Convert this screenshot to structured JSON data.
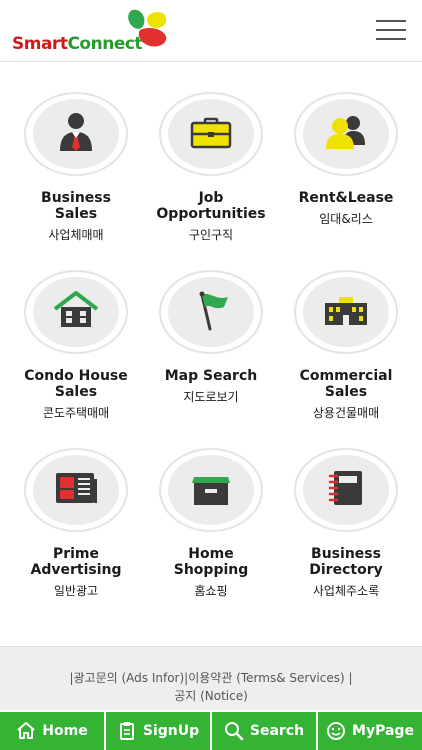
{
  "app": {
    "logo_part1": "Smart",
    "logo_part2": "Connect"
  },
  "colors": {
    "logo_red": "#d11a1a",
    "logo_green": "#2a9a2a",
    "icon_dark": "#3a3a3a",
    "icon_yellow": "#f0e200",
    "icon_green": "#2fa84f",
    "icon_red": "#e23030",
    "nav_green": "#35b335"
  },
  "menu": [
    {
      "label_en_1": "Business",
      "label_en_2": "Sales",
      "label_ko": "사업체매매",
      "icon": "businessman-icon"
    },
    {
      "label_en_1": "Job",
      "label_en_2": "Opportunities",
      "label_ko": "구인구직",
      "icon": "briefcase-icon"
    },
    {
      "label_en_1": "Rent&Lease",
      "label_en_2": "",
      "label_ko": "임대&리스",
      "icon": "people-icon"
    },
    {
      "label_en_1": "Condo House",
      "label_en_2": "Sales",
      "label_ko": "콘도주택매매",
      "icon": "house-icon"
    },
    {
      "label_en_1": "Map Search",
      "label_en_2": "",
      "label_ko": "지도로보기",
      "icon": "flag-icon"
    },
    {
      "label_en_1": "Commercial",
      "label_en_2": "Sales",
      "label_ko": "상용건물매매",
      "icon": "building-icon"
    },
    {
      "label_en_1": "Prime",
      "label_en_2": "Advertising",
      "label_ko": "일반광고",
      "icon": "newspaper-icon"
    },
    {
      "label_en_1": "Home",
      "label_en_2": "Shopping",
      "label_ko": "홈쇼핑",
      "icon": "box-icon"
    },
    {
      "label_en_1": "Business",
      "label_en_2": "Directory",
      "label_ko": "사업체주소록",
      "icon": "notebook-icon"
    }
  ],
  "footer": {
    "sep1": "|",
    "ads": "광고문의 (Ads Infor)",
    "sep2": "|",
    "terms": "이용약관 (Terms& Services)",
    "sep3": "|",
    "notice": "공지 (Notice)"
  },
  "bottom_nav": {
    "home": "Home",
    "signup": "SignUp",
    "search": "Search",
    "mypage": "MyPage"
  }
}
